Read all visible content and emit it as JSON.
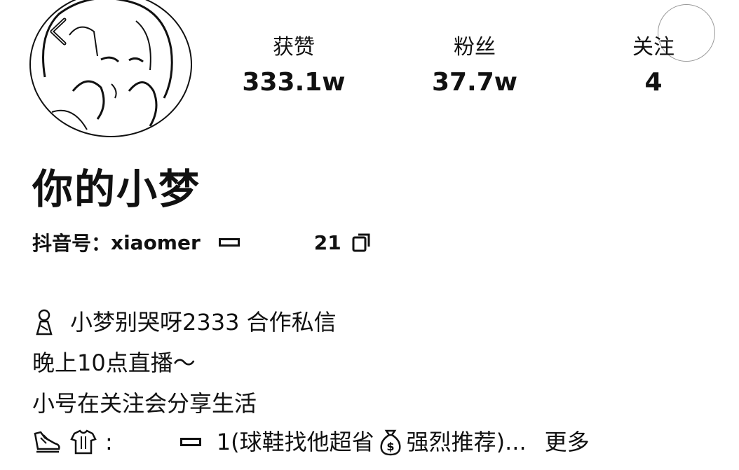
{
  "profile": {
    "stats": [
      {
        "label": "获赞",
        "value": "333.1w"
      },
      {
        "label": "粉丝",
        "value": "37.7w"
      },
      {
        "label": "关注",
        "value": "4"
      }
    ],
    "nickname": "你的小梦",
    "account_label": "抖音号：",
    "account_prefix": "xiaomer",
    "account_suffix": "21",
    "bio": {
      "line1": "小梦别哭呀2333 合作私信",
      "line2": "晚上10点直播～",
      "line3": "小号在关注会分享生活",
      "line4_colon": ":",
      "line4_a": "1(球鞋找他超省",
      "line4_b": "强烈推荐)...",
      "more_label": "更多"
    }
  }
}
